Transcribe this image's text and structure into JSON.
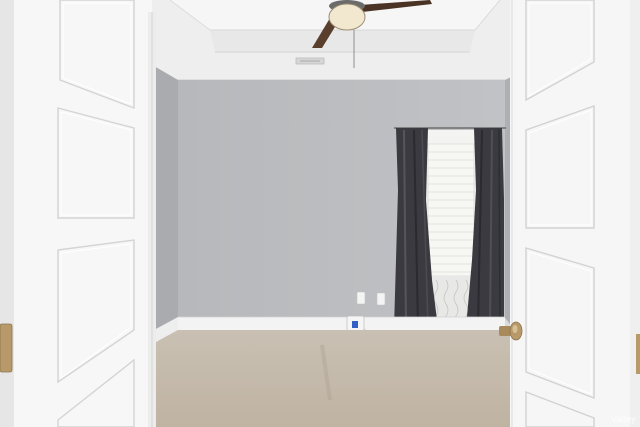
{
  "scene": {
    "description_label": "",
    "watermark_text": "Valley"
  },
  "colors": {
    "wall": "#b8babd",
    "ceiling": "#f1f1f1",
    "carpet": "#c7bcad",
    "door": "#f6f6f6",
    "curtain": "#3a3a40",
    "trim": "#ffffff",
    "hardware_brass": "#b89a6a"
  },
  "icons": [
    "ceiling-fan-icon",
    "door-handle-icon",
    "outlet-icon",
    "vent-icon"
  ]
}
